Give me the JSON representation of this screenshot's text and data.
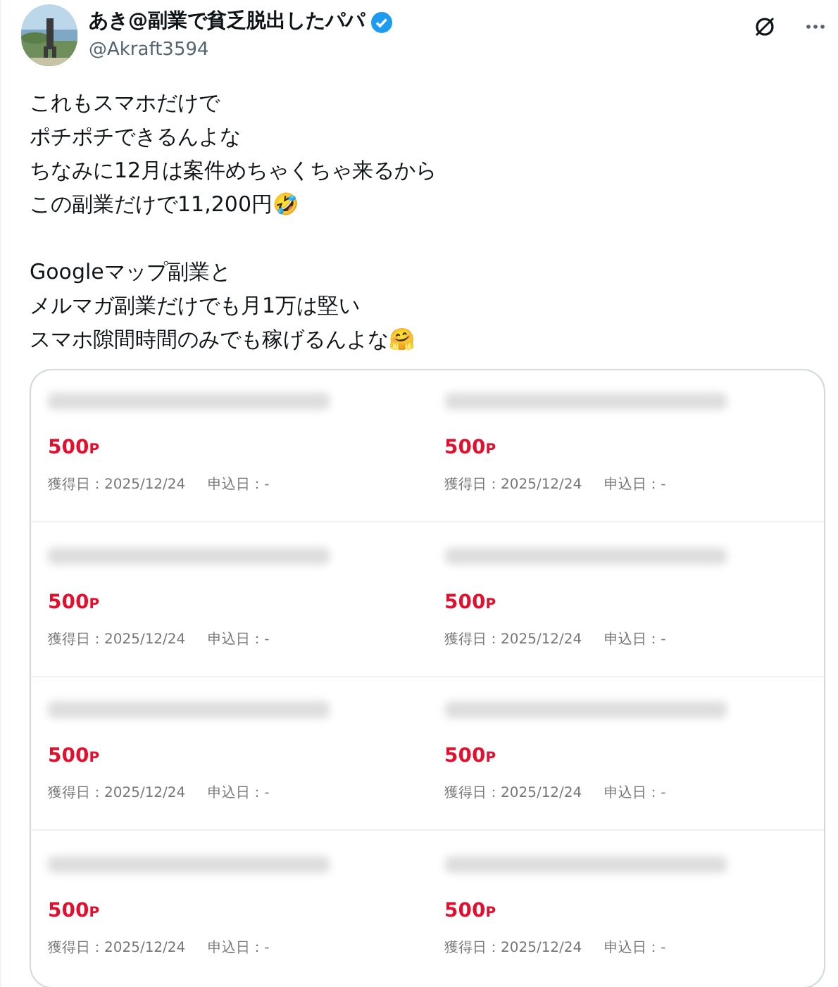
{
  "author": {
    "name": "あき@副業で貧乏脱出したパパ",
    "handle": "@Akraft3594",
    "verified": true
  },
  "body": [
    [
      "これもスマホだけで",
      "ポチポチできるんよな",
      "ちなみに12月は案件めちゃくちゃ来るから",
      "この副業だけで11,200円🤣"
    ],
    [
      "Googleマップ副業と",
      "メルマガ副業だけでも月1万は堅い",
      "スマホ隙間時間のみでも稼げるんよな🤗"
    ]
  ],
  "rewards": [
    {
      "points": "500",
      "unit": "P",
      "earned": "獲得日：2025/12/24",
      "applied": "申込日：-"
    },
    {
      "points": "500",
      "unit": "P",
      "earned": "獲得日：2025/12/24",
      "applied": "申込日：-"
    },
    {
      "points": "500",
      "unit": "P",
      "earned": "獲得日：2025/12/24",
      "applied": "申込日：-"
    },
    {
      "points": "500",
      "unit": "P",
      "earned": "獲得日：2025/12/24",
      "applied": "申込日：-"
    },
    {
      "points": "500",
      "unit": "P",
      "earned": "獲得日：2025/12/24",
      "applied": "申込日：-"
    },
    {
      "points": "500",
      "unit": "P",
      "earned": "獲得日：2025/12/24",
      "applied": "申込日：-"
    },
    {
      "points": "500",
      "unit": "P",
      "earned": "獲得日：2025/12/24",
      "applied": "申込日：-"
    },
    {
      "points": "500",
      "unit": "P",
      "earned": "獲得日：2025/12/24",
      "applied": "申込日：-"
    }
  ]
}
